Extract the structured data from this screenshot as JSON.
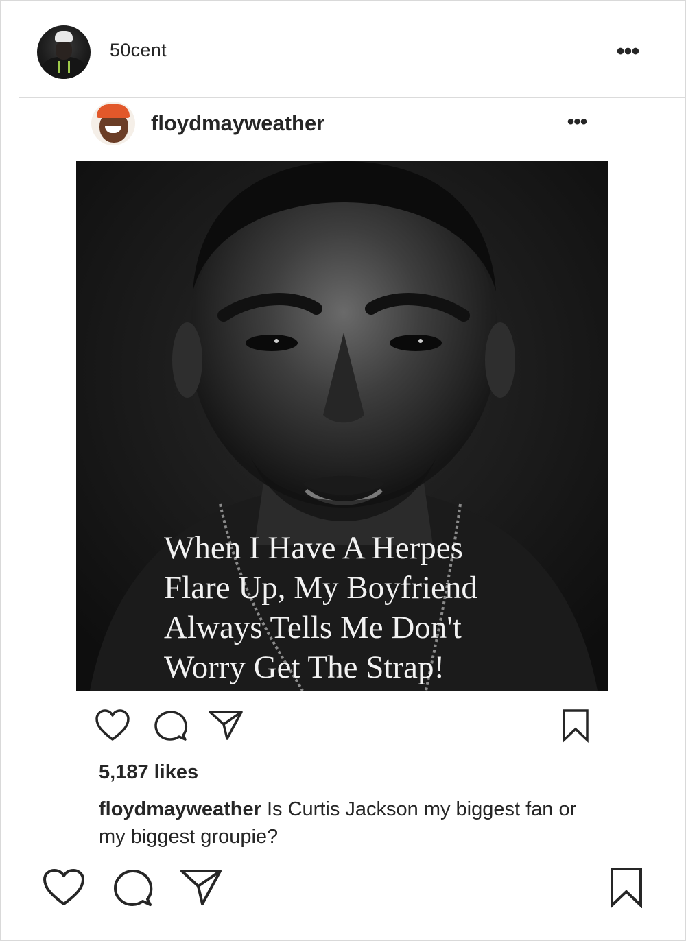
{
  "outer_post": {
    "username": "50cent",
    "more_label": "•••"
  },
  "inner_post": {
    "username": "floydmayweather",
    "more_label": "•••",
    "image_text_lines": [
      "When I Have A Herpes",
      "Flare Up, My Boyfriend",
      "Always Tells Me Don't",
      "Worry Get The Strap!"
    ],
    "likes": "5,187 likes",
    "caption_author": "floydmayweather",
    "caption_text": "Is Curtis Jackson my biggest fan or my biggest groupie?"
  },
  "icons": {
    "like": "heart-icon",
    "comment": "comment-bubble-icon",
    "share": "paper-plane-icon",
    "save": "bookmark-icon",
    "more": "more-dots-icon"
  },
  "colors": {
    "text": "#262626",
    "divider": "#dbdbdb",
    "border": "#d9d9d9",
    "photo_background": "#131313",
    "image_text": "#f2f2f2"
  }
}
